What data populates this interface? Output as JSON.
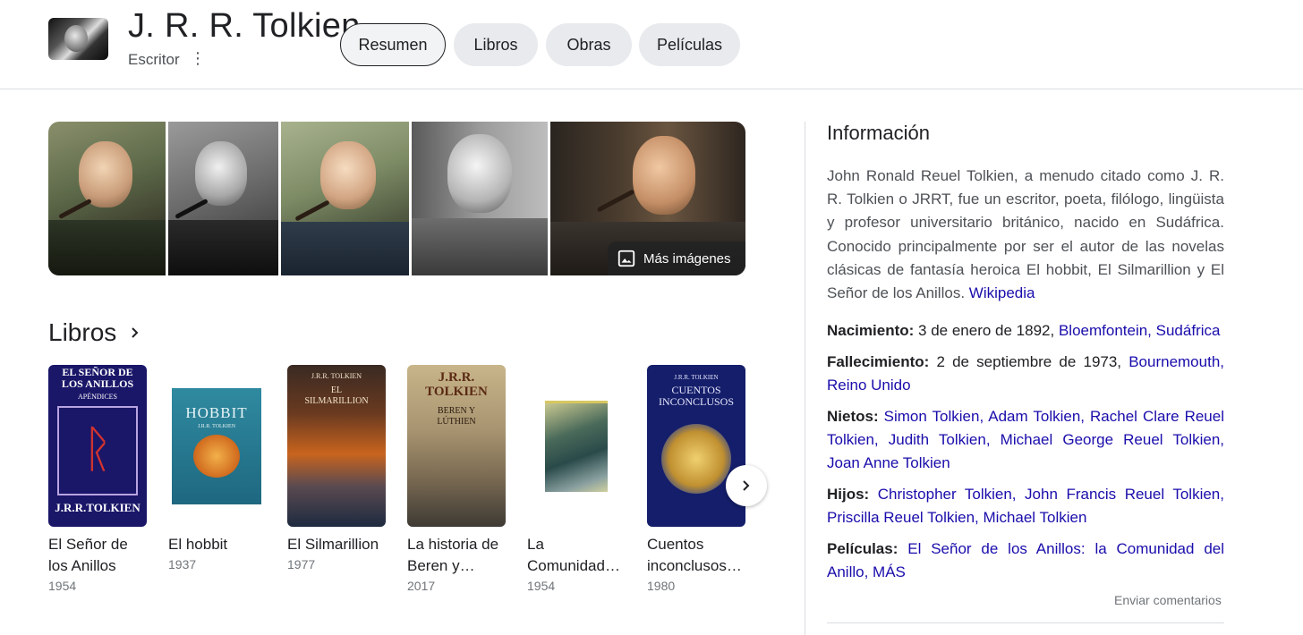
{
  "header": {
    "title": "J. R. R. Tolkien",
    "subtitle": "Escritor",
    "tabs": [
      {
        "label": "Resumen",
        "active": true
      },
      {
        "label": "Libros",
        "active": false
      },
      {
        "label": "Obras",
        "active": false
      },
      {
        "label": "Películas",
        "active": false
      }
    ]
  },
  "gallery": {
    "more_images_label": "Más imágenes"
  },
  "books": {
    "heading": "Libros",
    "items": [
      {
        "title": "El Señor de los Anillos",
        "year": "1954",
        "cover": {
          "top": "EL SEÑOR DE LOS ANILLOS",
          "sub": "APÉNDICES",
          "bottom": "J.R.R.TOLKIEN"
        }
      },
      {
        "title": "El hobbit",
        "year": "1937",
        "cover": {
          "top": "HOBBIT",
          "sub": "J.R.R. TOLKIEN",
          "bottom": ""
        }
      },
      {
        "title": "El Silmarillion",
        "year": "1977",
        "cover": {
          "top": "J.R.R. TOLKIEN",
          "sub": "EL SILMARILLION",
          "bottom": ""
        }
      },
      {
        "title": "La historia de Beren y…",
        "year": "2017",
        "cover": {
          "top": "J.R.R. TOLKIEN",
          "sub": "BEREN Y LÚTHIEN",
          "bottom": ""
        }
      },
      {
        "title": "La Comunidad…",
        "year": "1954",
        "cover": {
          "top": "",
          "sub": "",
          "bottom": ""
        }
      },
      {
        "title": "Cuentos inconclusos…",
        "year": "1980",
        "cover": {
          "top": "J.R.R. TOLKIEN",
          "sub": "CUENTOS INCONCLUSOS",
          "bottom": ""
        }
      }
    ]
  },
  "info": {
    "heading": "Información",
    "description": "John Ronald Reuel Tolkien, a menudo citado como J. R. R. Tolkien o JRRT, fue un escritor, poeta, filólogo, lingüista y profesor universitario británico, nacido en Sudáfrica. Conocido principalmente por ser el autor de las novelas clásicas de fantasía heroica El hobbit, El Silmarillion y El Señor de los Anillos.",
    "source_link": "Wikipedia",
    "facts": {
      "nacimiento": {
        "label": "Nacimiento:",
        "text": "3 de enero de 1892,",
        "links": [
          "Bloemfontein,",
          "Sudáfrica"
        ]
      },
      "fallecimiento": {
        "label": "Fallecimiento:",
        "text": "2 de septiembre de 1973,",
        "links": [
          "Bournemouth,",
          "Reino Unido"
        ]
      },
      "nietos": {
        "label": "Nietos:",
        "links": [
          "Simon Tolkien,",
          "Adam Tolkien,",
          "Rachel Clare Reuel Tolkien,",
          "Judith Tolkien,",
          "Michael George Reuel Tolkien,",
          "Joan Anne Tolkien"
        ]
      },
      "hijos": {
        "label": "Hijos:",
        "links": [
          "Christopher Tolkien,",
          "John Francis Reuel Tolkien,",
          "Priscilla Reuel Tolkien,",
          "Michael Tolkien"
        ]
      },
      "peliculas": {
        "label": "Películas:",
        "links": [
          "El Señor de los Anillos: la Comunidad del Anillo,",
          "MÁS"
        ]
      }
    },
    "feedback": "Enviar comentarios"
  },
  "colors": {
    "link": "#1a0dab",
    "text": "#202124",
    "muted": "#70757a",
    "chip": "#e8eaed"
  }
}
